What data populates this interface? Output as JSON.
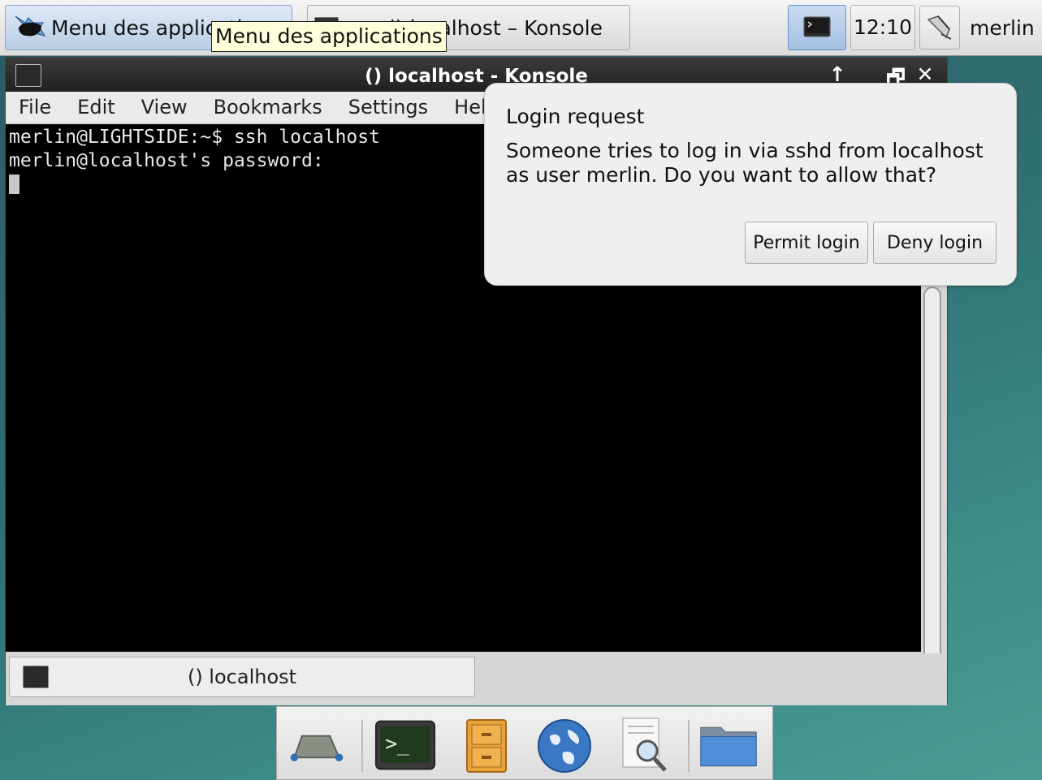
{
  "top_panel": {
    "app_menu_label": "Menu des applications",
    "tooltip": "Menu des applications",
    "task_label": "() localhost – Konsole",
    "clock": "12:10",
    "user": "merlin"
  },
  "window": {
    "title": "() localhost - Konsole",
    "controls": {
      "keep_above": "↑",
      "minimize": "_",
      "restore": "🗗",
      "close": "✕"
    },
    "menu": [
      "File",
      "Edit",
      "View",
      "Bookmarks",
      "Settings",
      "Help"
    ],
    "terminal_lines": [
      "merlin@LIGHTSIDE:~$ ssh localhost",
      "merlin@localhost's password:"
    ],
    "tab_label": "() localhost"
  },
  "notification": {
    "title": "Login request",
    "body": "Someone tries to log in via sshd from localhost as user merlin. Do you want to allow that?",
    "permit": "Permit login",
    "deny": "Deny login"
  },
  "dock": {
    "items": [
      "show-desktop-icon",
      "terminal-icon",
      "file-cabinet-icon",
      "web-browser-icon",
      "search-icon",
      "folder-icon"
    ]
  }
}
